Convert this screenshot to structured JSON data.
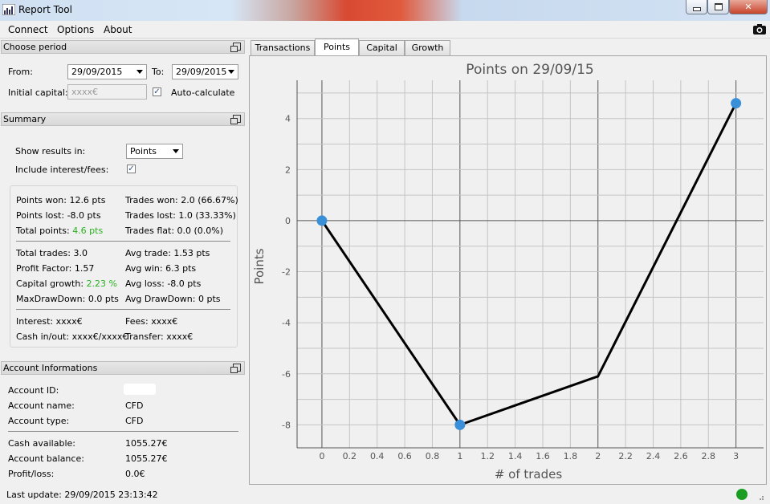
{
  "window": {
    "title": "Report Tool"
  },
  "menu": [
    "Connect",
    "Options",
    "About"
  ],
  "period": {
    "header": "Choose period",
    "from_label": "From:",
    "from_value": "29/09/2015",
    "to_label": "To:",
    "to_value": "29/09/2015",
    "initial_capital_label": "Initial capital:",
    "initial_capital_placeholder": "xxxx€",
    "auto_calculate_label": "Auto-calculate"
  },
  "summary": {
    "header": "Summary",
    "show_results_label": "Show results in:",
    "show_results_value": "Points",
    "include_interest_label": "Include interest/fees:",
    "left": [
      [
        "Points won: 12.6 pts",
        "Points lost: -8.0 pts"
      ],
      [
        "Total points: ",
        "4.6 pts"
      ],
      [
        "Total trades: 3.0",
        "Profit Factor: 1.57"
      ],
      [
        "Capital growth: ",
        "2.23 %"
      ],
      [
        "MaxDrawDown: 0.0 pts"
      ],
      [
        "Interest: xxxx€",
        "Cash in/out: xxxx€/xxxx€"
      ]
    ],
    "points_won": "Points won: 12.6 pts",
    "points_lost": "Points lost: -8.0 pts",
    "total_points_label": "Total points:",
    "total_points_value": "4.6 pts",
    "trades_won": "Trades won: 2.0 (66.67%)",
    "trades_lost": "Trades lost: 1.0 (33.33%)",
    "trades_flat": "Trades flat: 0.0 (0.0%)",
    "total_trades": "Total trades: 3.0",
    "profit_factor": "Profit Factor: 1.57",
    "capital_growth_label": "Capital growth:",
    "capital_growth_value": "2.23 %",
    "max_drawdown": "MaxDrawDown: 0.0 pts",
    "avg_trade": "Avg trade: 1.53 pts",
    "avg_win": "Avg win: 6.3 pts",
    "avg_loss": "Avg loss: -8.0 pts",
    "avg_drawdown": "Avg DrawDown: 0 pts",
    "interest": "Interest: xxxx€",
    "cash_in_out": "Cash in/out: xxxx€/xxxx€",
    "fees": "Fees: xxxx€",
    "transfer": "Transfer: xxxx€",
    "positive_color": "#29b11e"
  },
  "account": {
    "header": "Account Informations",
    "id_label": "Account ID:",
    "name_label": "Account name:",
    "name_value": "CFD",
    "type_label": "Account type:",
    "type_value": "CFD",
    "cash_label": "Cash available:",
    "cash_value": "1055.27€",
    "balance_label": "Account balance:",
    "balance_value": "1055.27€",
    "pl_label": "Profit/loss:",
    "pl_value": "0.0€"
  },
  "tabs": [
    "Transactions",
    "Points",
    "Capital",
    "Growth"
  ],
  "active_tab": "Points",
  "status": {
    "last_update": "Last update: 29/09/2015 23:13:42",
    "connection_color": "#1a9e22"
  },
  "chart_data": {
    "type": "line",
    "title": "Points on 29/09/15",
    "xlabel": "# of trades",
    "ylabel": "Points",
    "x": [
      0,
      1,
      2,
      3
    ],
    "y": [
      0,
      -8.0,
      -6.1,
      4.6
    ],
    "markers_at": [
      0,
      1,
      3
    ],
    "xlim": [
      -0.18,
      3.2
    ],
    "ylim": [
      -8.9,
      5.5
    ],
    "xticks": [
      "0",
      "0.2",
      "0.4",
      "0.6",
      "0.8",
      "1",
      "1.2",
      "1.4",
      "1.6",
      "1.8",
      "2",
      "2.2",
      "2.4",
      "2.6",
      "2.8",
      "3"
    ],
    "yticks": [
      "4",
      "2",
      "0",
      "-2",
      "-4",
      "-6",
      "-8"
    ],
    "grid": true,
    "line_color": "#000000",
    "marker_color": "#3a8fd9"
  }
}
